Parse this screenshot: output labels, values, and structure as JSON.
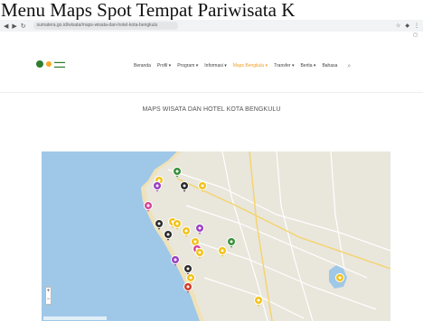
{
  "caption": "Menu Maps Spot Tempat Pariwisata K",
  "browser": {
    "url": "sumatera.go.id/wisata/maps-wisata-dan-hotel-kota-bengkulu"
  },
  "site": {
    "menu": [
      "Beranda",
      "Profil",
      "Program",
      "Informasi",
      "Maps Bengkulu",
      "Transfer",
      "Berita",
      "Bahasa"
    ],
    "active_index": 4
  },
  "page_title": "MAPS WISATA DAN HOTEL KOTA BENGKULU",
  "map": {
    "markers": [
      {
        "type": "yellow"
      },
      {
        "type": "purple"
      },
      {
        "type": "green"
      },
      {
        "type": "black"
      },
      {
        "type": "yellow"
      },
      {
        "type": "pink"
      },
      {
        "type": "yellow"
      },
      {
        "type": "black"
      },
      {
        "type": "yellow"
      },
      {
        "type": "purple"
      },
      {
        "type": "yellow"
      },
      {
        "type": "black"
      },
      {
        "type": "yellow"
      },
      {
        "type": "pink"
      },
      {
        "type": "purple"
      },
      {
        "type": "yellow"
      },
      {
        "type": "black"
      },
      {
        "type": "yellow"
      },
      {
        "type": "red"
      },
      {
        "type": "yellow"
      },
      {
        "type": "green"
      },
      {
        "type": "yellow"
      },
      {
        "type": "yellow"
      }
    ],
    "marker_colors": {
      "yellow": "#f2c21a",
      "purple": "#9b3fc2",
      "green": "#3a8f3a",
      "black": "#2a2a2a",
      "pink": "#d6459a",
      "red": "#d23a2a"
    }
  }
}
